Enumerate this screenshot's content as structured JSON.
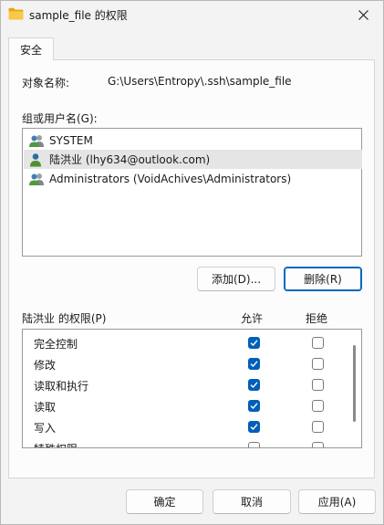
{
  "window": {
    "title": "sample_file 的权限"
  },
  "tabs": [
    {
      "label": "安全"
    }
  ],
  "object": {
    "label": "对象名称:",
    "value": "G:\\Users\\Entropy\\.ssh\\sample_file"
  },
  "groups": {
    "label": "组或用户名(G):",
    "items": [
      {
        "label": "SYSTEM",
        "selected": false,
        "icon": "users-group-icon"
      },
      {
        "label": "陆洪业 (lhy634@outlook.com)",
        "selected": true,
        "icon": "user-icon"
      },
      {
        "label": "Administrators (VoidAchives\\Administrators)",
        "selected": false,
        "icon": "users-group-icon"
      }
    ],
    "add_label": "添加(D)...",
    "remove_label": "删除(R)"
  },
  "permissions": {
    "label": "陆洪业 的权限(P)",
    "allow_header": "允许",
    "deny_header": "拒绝",
    "rows": [
      {
        "name": "完全控制",
        "allow": true,
        "deny": false
      },
      {
        "name": "修改",
        "allow": true,
        "deny": false
      },
      {
        "name": "读取和执行",
        "allow": true,
        "deny": false
      },
      {
        "name": "读取",
        "allow": true,
        "deny": false
      },
      {
        "name": "写入",
        "allow": true,
        "deny": false
      },
      {
        "name": "特殊权限",
        "allow": false,
        "deny": false
      }
    ]
  },
  "footer": {
    "ok_label": "确定",
    "cancel_label": "取消",
    "apply_label": "应用(A)"
  },
  "colors": {
    "accent": "#005fb8",
    "selection": "#e5e5e5",
    "folder": "#f4c33b"
  }
}
